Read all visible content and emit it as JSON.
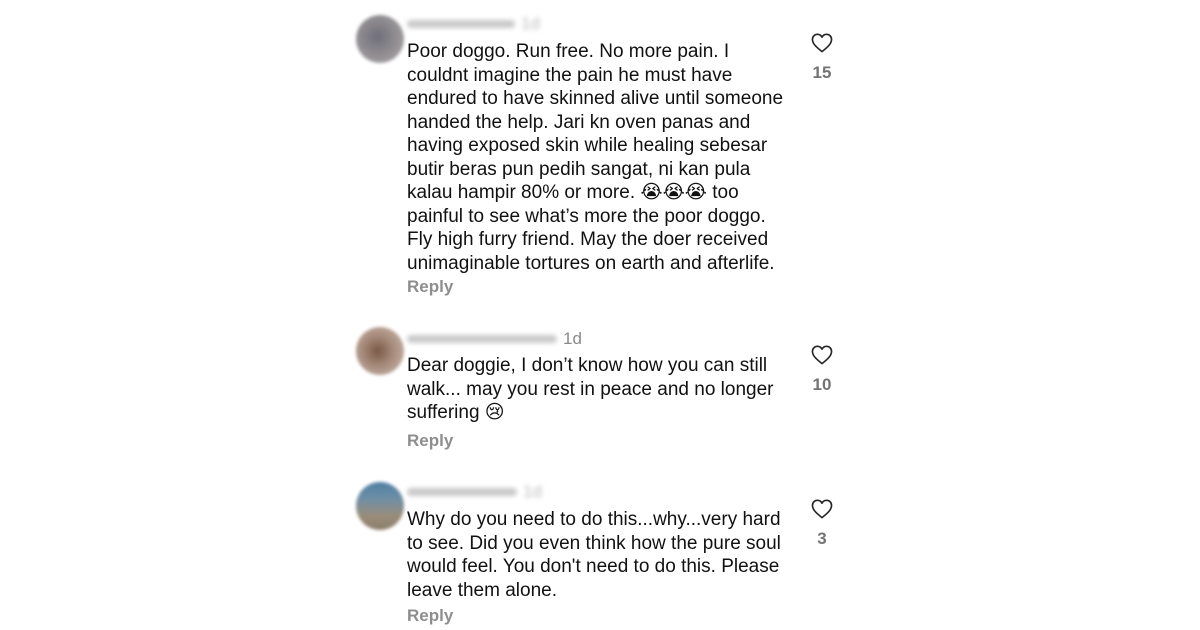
{
  "comments": [
    {
      "time": "1d",
      "text": "Poor doggo. Run free. No more pain. I\ncouldnt imagine the pain he must have\nendured to have skinned alive until someone\nhanded the help. Jari kn oven panas and\nhaving exposed skin while healing sebesar\nbutir beras pun pedih sangat, ni kan pula\nkalau hampir 80% or more. 😭😭😭 too\npainful to see what’s more the poor doggo.\nFly high furry friend. May the doer received\nunimaginable tortures on earth and afterlife.",
      "reply_label": "Reply",
      "likes": "15",
      "like_icon": "heart-outline-icon"
    },
    {
      "time": "1d",
      "text": "Dear doggie, I don’t know how you can still\nwalk... may you rest in peace and no longer\nsuffering 😢",
      "reply_label": "Reply",
      "likes": "10",
      "like_icon": "heart-outline-icon"
    },
    {
      "time": "1d",
      "text": "Why do you need to do this...why...very hard\nto see. Did you even think how the pure soul\nwould feel. You don't need to do this. Please\nleave them alone.",
      "reply_label": "Reply",
      "likes": "3",
      "like_icon": "heart-outline-icon"
    }
  ],
  "colors": {
    "text": "#111111",
    "secondary": "#8e8e8e",
    "like_count": "#737373",
    "background": "#ffffff"
  }
}
